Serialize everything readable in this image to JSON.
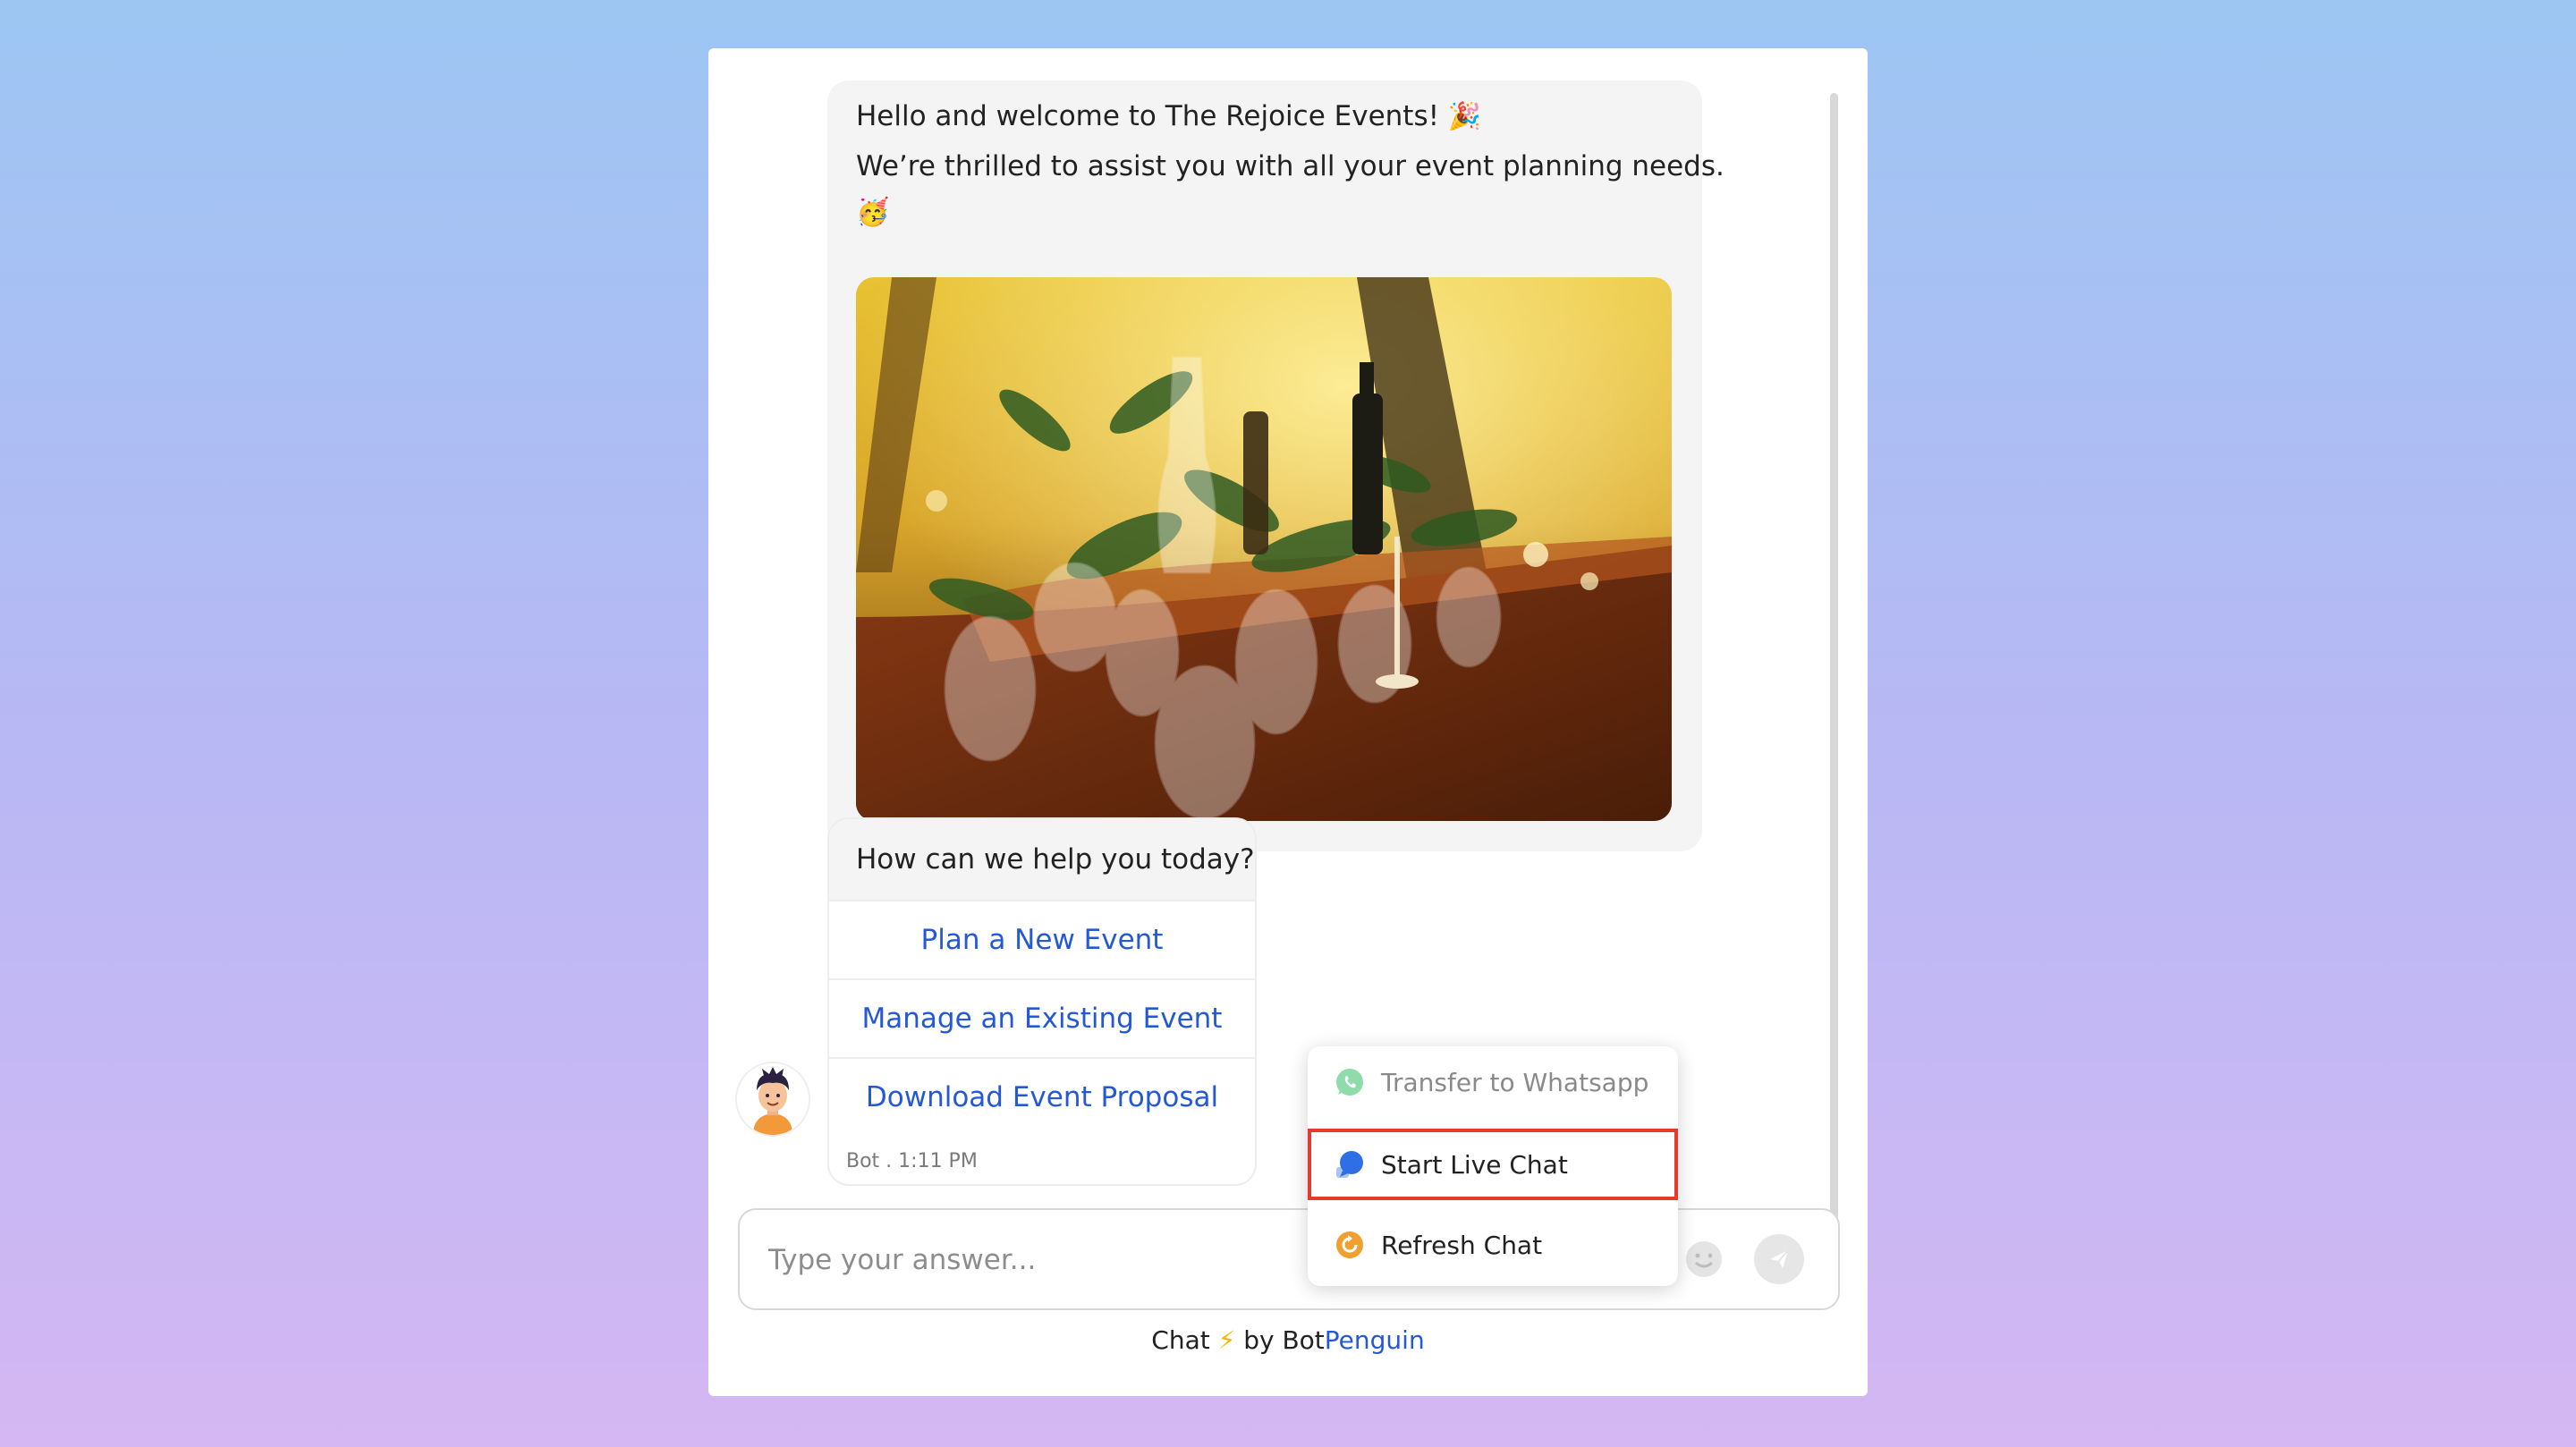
{
  "welcome": {
    "line1": "Hello and welcome to The Rejoice Events!",
    "line1_emoji": "🎉",
    "line2": "We’re thrilled to assist you with all your event planning needs.",
    "line2_emoji": "🥳"
  },
  "question": {
    "text": "How can we help you today?",
    "options": [
      {
        "label": "Plan a New Event"
      },
      {
        "label": "Manage an Existing Event"
      },
      {
        "label": "Download Event Proposal"
      }
    ]
  },
  "message_meta": "Bot . 1:11 PM",
  "input": {
    "placeholder": "Type your answer..."
  },
  "menu": {
    "items": [
      {
        "label": "Transfer to Whatsapp",
        "icon": "whatsapp-icon",
        "state": "disabled"
      },
      {
        "label": "Start Live Chat",
        "icon": "chat-bubble-icon",
        "state": "highlighted"
      },
      {
        "label": "Refresh Chat",
        "icon": "refresh-icon",
        "state": "normal"
      }
    ]
  },
  "footer": {
    "prefix": "Chat",
    "bolt": "⚡",
    "by": "by Bot",
    "brand": "Penguin"
  },
  "colors": {
    "accent": "#2458d6",
    "highlight_border": "#e43b2c",
    "whatsapp": "#25d366",
    "live_chat": "#2f6fe6",
    "refresh": "#f0a030"
  }
}
